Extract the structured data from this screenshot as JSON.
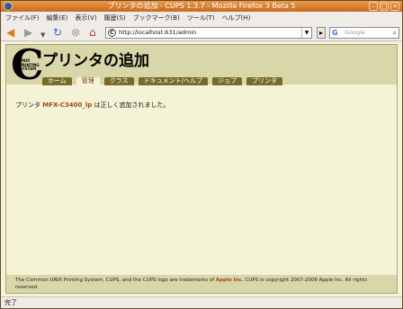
{
  "window": {
    "title": "プリンタの追加 - CUPS 1.3.7 - Mozilla Firefox 3 Beta 5"
  },
  "menu": [
    "ファイル(F)",
    "編集(E)",
    "表示(V)",
    "履歴(S)",
    "ブックマーク(B)",
    "ツール(T)",
    "ヘルプ(H)"
  ],
  "toolbar": {
    "url": "http://localhost:631/admin",
    "search_placeholder": "Google"
  },
  "header": {
    "title": "プリンタの追加",
    "logo_text": "UNIX PRINTING SYSTEM",
    "logo_letter": "C"
  },
  "tabs": [
    {
      "label": "ホーム",
      "active": false
    },
    {
      "label": "管理",
      "active": true
    },
    {
      "label": "クラス",
      "active": false
    },
    {
      "label": "ドキュメント/ヘルプ",
      "active": false
    },
    {
      "label": "ジョブ",
      "active": false
    },
    {
      "label": "プリンタ",
      "active": false
    }
  ],
  "message": {
    "prefix": "プリンタ",
    "printer_name": "MFX-C3400_lp",
    "suffix": "は正しく追加されました。"
  },
  "footer": {
    "text_before": "The Common UNIX Printing System, CUPS, and the CUPS logo are trademarks of",
    "link": "Apple Inc.",
    "text_after": "CUPS is copyright 2007-2008 Apple Inc. All rights reserved."
  },
  "status": "完了"
}
